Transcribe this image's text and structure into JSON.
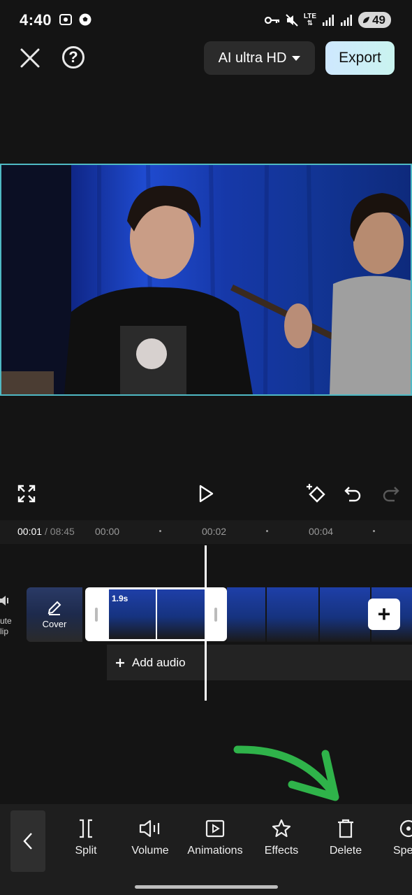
{
  "status_bar": {
    "time": "4:40",
    "battery": "49",
    "network": "LTE"
  },
  "top_bar": {
    "quality_label": "AI ultra HD",
    "export_label": "Export",
    "help_glyph": "?"
  },
  "timeline": {
    "current_time": "00:01",
    "total_time": "/ 08:45",
    "ruler_ticks": [
      "00:00",
      "00:02",
      "00:04"
    ],
    "mute_label": "ute\nlip",
    "cover_label": "Cover",
    "clip_duration": "1.9s",
    "add_audio_label": "Add audio"
  },
  "toolbar": {
    "items": [
      {
        "label": "Split",
        "icon": "split-icon"
      },
      {
        "label": "Volume",
        "icon": "volume-icon"
      },
      {
        "label": "Animations",
        "icon": "animations-icon"
      },
      {
        "label": "Effects",
        "icon": "effects-icon"
      },
      {
        "label": "Delete",
        "icon": "delete-icon"
      },
      {
        "label": "Spe",
        "icon": "speed-icon"
      }
    ]
  },
  "colors": {
    "accent_border": "#4fb9c4",
    "annotation_arrow": "#2fb34a",
    "export_gradient": [
      "#cfe8ff",
      "#c9f4ef"
    ]
  }
}
